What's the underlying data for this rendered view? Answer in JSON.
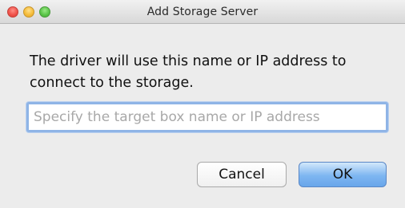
{
  "window": {
    "title": "Add Storage Server"
  },
  "dialog": {
    "message": "The driver will use this name or IP address to connect to the storage.",
    "input": {
      "value": "",
      "placeholder": "Specify the target box name or IP address"
    },
    "buttons": {
      "cancel_label": "Cancel",
      "ok_label": "OK"
    }
  },
  "colors": {
    "close": "#f0544c",
    "minimize": "#f5bd3c",
    "zoom": "#5cc64a",
    "focus_ring": "#8fb4e6",
    "default_button": "#7eb6f1"
  }
}
